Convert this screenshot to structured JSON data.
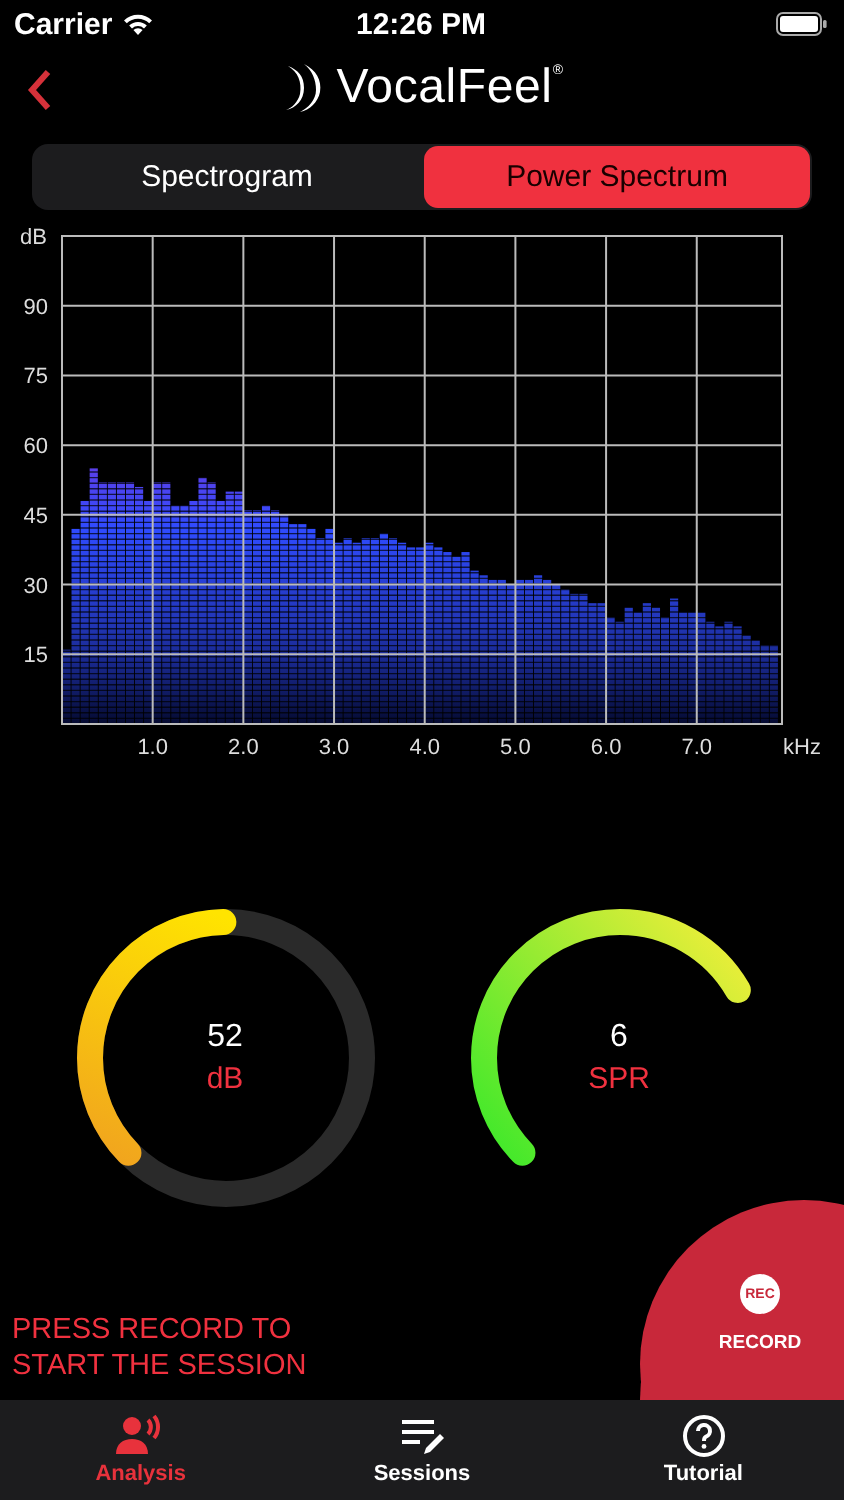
{
  "status_bar": {
    "carrier": "Carrier",
    "time": "12:26 PM"
  },
  "header": {
    "logo_text": "VocalFeel$^{®}$"
  },
  "segments": [
    {
      "label": "Spectrogram",
      "selected": false
    },
    {
      "label": "Power Spectrum",
      "selected": true
    }
  ],
  "power_spectrum": {
    "chart_data": {
      "type": "bar",
      "grid": true,
      "xlabel": "kHz",
      "ylabel": "dB",
      "xlim": [
        0,
        7.94
      ],
      "ylim": [
        0,
        105
      ],
      "xticks": [
        {
          "value": 1,
          "label": "1.0"
        },
        {
          "value": 2,
          "label": "2.0"
        },
        {
          "value": 3,
          "label": "3.0"
        },
        {
          "value": 4,
          "label": "4.0"
        },
        {
          "value": 5,
          "label": "5.0"
        },
        {
          "value": 6,
          "label": "6.0"
        },
        {
          "value": 7,
          "label": "7.0"
        }
      ],
      "yticks": [
        15,
        30,
        45,
        60,
        75,
        90
      ],
      "x": [
        0.05,
        0.15,
        0.25,
        0.35,
        0.45,
        0.55,
        0.65,
        0.75,
        0.85,
        0.95,
        1.05,
        1.15,
        1.25,
        1.35,
        1.45,
        1.55,
        1.65,
        1.75,
        1.85,
        1.95,
        2.05,
        2.15,
        2.25,
        2.35,
        2.45,
        2.55,
        2.65,
        2.75,
        2.85,
        2.95,
        3.05,
        3.15,
        3.25,
        3.35,
        3.45,
        3.55,
        3.65,
        3.75,
        3.85,
        3.95,
        4.05,
        4.15,
        4.25,
        4.35,
        4.45,
        4.55,
        4.65,
        4.75,
        4.85,
        4.95,
        5.05,
        5.15,
        5.25,
        5.35,
        5.45,
        5.55,
        5.65,
        5.75,
        5.85,
        5.95,
        6.05,
        6.15,
        6.25,
        6.35,
        6.45,
        6.55,
        6.65,
        6.75,
        6.85,
        6.95,
        7.05,
        7.15,
        7.25,
        7.35,
        7.45,
        7.55,
        7.65,
        7.75,
        7.85
      ],
      "series": [
        {
          "color": "#2f4bff",
          "values": [
            16,
            42,
            48,
            55,
            52,
            52,
            52,
            52,
            51,
            48,
            52,
            52,
            47,
            47,
            48,
            53,
            52,
            48,
            50,
            50,
            46,
            46,
            47,
            46,
            45,
            43,
            43,
            42,
            40,
            42,
            39,
            40,
            39,
            40,
            40,
            41,
            40,
            39,
            38,
            38,
            39,
            38,
            37,
            36,
            37,
            33,
            32,
            31,
            31,
            30,
            31,
            31,
            32,
            31,
            30,
            29,
            28,
            28,
            26,
            26,
            23,
            22,
            25,
            24,
            26,
            25,
            23,
            27,
            24,
            24,
            24,
            22,
            21,
            22,
            21,
            19,
            18,
            17,
            17
          ]
        }
      ]
    }
  },
  "gauges": [
    {
      "kind": "ring",
      "value": "52",
      "unit": "dB",
      "level": 0.37
    },
    {
      "kind": "arc",
      "value": "6",
      "unit": "SPR",
      "level": 0.54
    }
  ],
  "prompt": "PRESS RECORD TO START THE SESSION",
  "record": {
    "icon_text": "REC",
    "label": "RECORD"
  },
  "tab_bar": [
    {
      "label": "Analysis",
      "selected": true
    },
    {
      "label": "Sessions",
      "selected": false
    },
    {
      "label": "Tutorial",
      "selected": false
    }
  ]
}
